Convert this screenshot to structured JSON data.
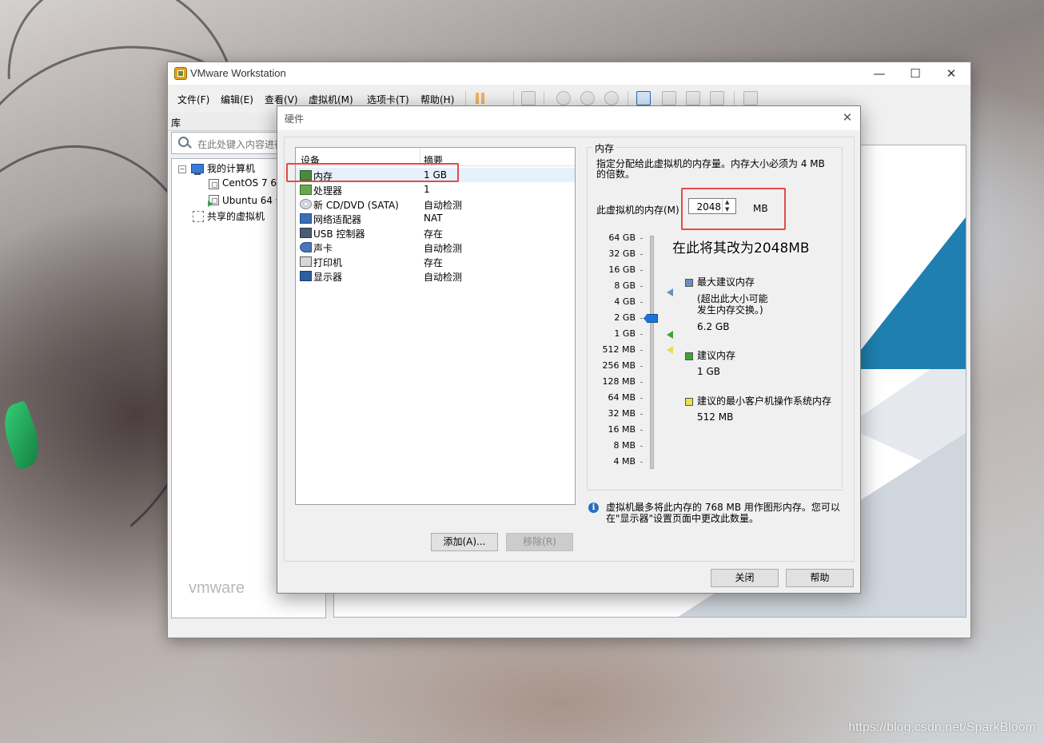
{
  "app": {
    "title": "VMware Workstation",
    "window_controls": {
      "minimize": "—",
      "maximize": "☐",
      "close": "✕"
    },
    "menu": [
      "文件(F)",
      "编辑(E)",
      "查看(V)",
      "虚拟机(M)",
      "选项卡(T)",
      "帮助(H)"
    ],
    "library": {
      "title": "库",
      "search_placeholder": "在此处键入内容进行",
      "tree": {
        "root": "我的计算机",
        "vms": [
          "CentOS 7 64",
          "Ubuntu 64 位"
        ],
        "shared": "共享的虚拟机"
      }
    },
    "home_faint_text": "vmware"
  },
  "dialog": {
    "title": "硬件",
    "close": "✕",
    "device_list": {
      "col_device": "设备",
      "col_summary": "摘要",
      "rows": [
        {
          "name": "内存",
          "summary": "1 GB",
          "icon": "memory-icon"
        },
        {
          "name": "处理器",
          "summary": "1",
          "icon": "processor-icon"
        },
        {
          "name": "新 CD/DVD (SATA)",
          "summary": "自动检测",
          "icon": "cd-dvd-icon"
        },
        {
          "name": "网络适配器",
          "summary": "NAT",
          "icon": "network-adapter-icon"
        },
        {
          "name": "USB 控制器",
          "summary": "存在",
          "icon": "usb-icon"
        },
        {
          "name": "声卡",
          "summary": "自动检测",
          "icon": "sound-card-icon"
        },
        {
          "name": "打印机",
          "summary": "存在",
          "icon": "printer-icon"
        },
        {
          "name": "显示器",
          "summary": "自动检测",
          "icon": "display-icon"
        }
      ]
    },
    "add_button": "添加(A)...",
    "remove_button": "移除(R)",
    "memory": {
      "legend": "内存",
      "description": "指定分配给此虚拟机的内存量。内存大小必须为 4 MB 的倍数。",
      "label": "此虚拟机的内存(M)",
      "value": "2048",
      "unit": "MB",
      "scale": [
        "64 GB",
        "32 GB",
        "16 GB",
        "8 GB",
        "4 GB",
        "2 GB",
        "1 GB",
        "512 MB",
        "256 MB",
        "128 MB",
        "64 MB",
        "32 MB",
        "16 MB",
        "8 MB",
        "4 MB"
      ],
      "slider_value": "2 GB",
      "max_recommended": {
        "title": "最大建议内存",
        "note_line1": "(超出此大小可能",
        "note_line2": "发生内存交换。)",
        "value": "6.2 GB",
        "color": "#6a8fbf"
      },
      "recommended": {
        "title": "建议内存",
        "value": "1 GB",
        "color": "#3aa63a"
      },
      "min_recommended": {
        "title": "建议的最小客户机操作系统内存",
        "value": "512 MB",
        "color": "#e8e04a"
      },
      "info": "虚拟机最多将此内存的 768 MB 用作图形内存。您可以在\"显示器\"设置页面中更改此数量。"
    },
    "close_button": "关闭",
    "help_button": "帮助"
  },
  "annotation": "在此将其改为2048MB",
  "annotation_color": "#e24a4a",
  "watermark": "https://blog.csdn.net/SparkBloom"
}
